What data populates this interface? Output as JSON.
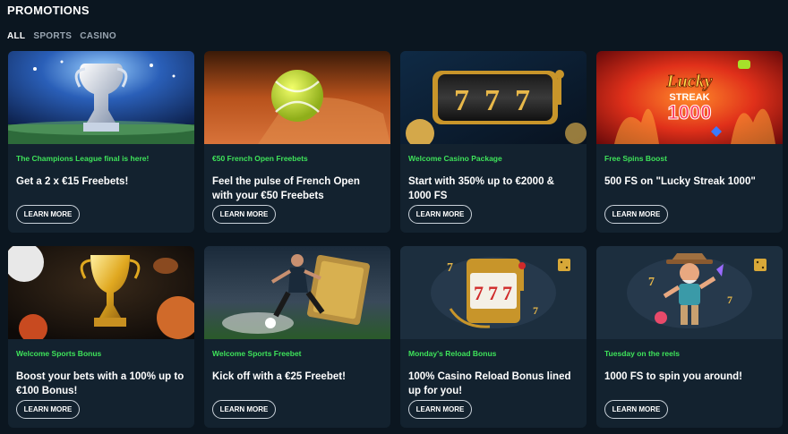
{
  "header": {
    "title": "PROMOTIONS"
  },
  "filters": [
    {
      "label": "ALL",
      "active": true
    },
    {
      "label": "SPORTS",
      "active": false
    },
    {
      "label": "CASINO",
      "active": false
    }
  ],
  "colors": {
    "background": "#0b1620",
    "card": "#13222f",
    "accent_green": "#3ee35a",
    "muted_tab": "#9aa6b2"
  },
  "cards": [
    {
      "category": "The Champions League final is here!",
      "title": "Get a 2 x €15 Freebets!",
      "button": "LEARN MORE",
      "image": "champions-league-trophy-image"
    },
    {
      "category": "€50 French Open Freebets",
      "title": "Feel the pulse of French Open with your €50 Freebets",
      "button": "LEARN MORE",
      "image": "tennis-ball-clay-image"
    },
    {
      "category": "Welcome Casino Package",
      "title": "Start with 350% up to €2000 & 1000 FS",
      "button": "LEARN MORE",
      "image": "slot-777-image"
    },
    {
      "category": "Free Spins Boost",
      "title": "500 FS on \"Lucky Streak 1000\"",
      "button": "LEARN MORE",
      "image": "lucky-streak-logo-image",
      "logo_text": [
        "Lucky",
        "STREAK",
        "1000"
      ]
    },
    {
      "category": "Welcome Sports Bonus",
      "title": "Boost your bets with a 100% up to €100 Bonus!",
      "button": "LEARN MORE",
      "image": "gold-trophy-balls-image"
    },
    {
      "category": "Welcome Sports Freebet",
      "title": "Kick off with a €25 Freebet!",
      "button": "LEARN MORE",
      "image": "football-player-ticket-image"
    },
    {
      "category": "Monday's Reload Bonus",
      "title": "100% Casino Reload Bonus lined up for you!",
      "button": "LEARN MORE",
      "image": "slot-machine-777-image"
    },
    {
      "category": "Tuesday on the reels",
      "title": "1000 FS to spin you around!",
      "button": "LEARN MORE",
      "image": "cowboy-character-image"
    }
  ]
}
